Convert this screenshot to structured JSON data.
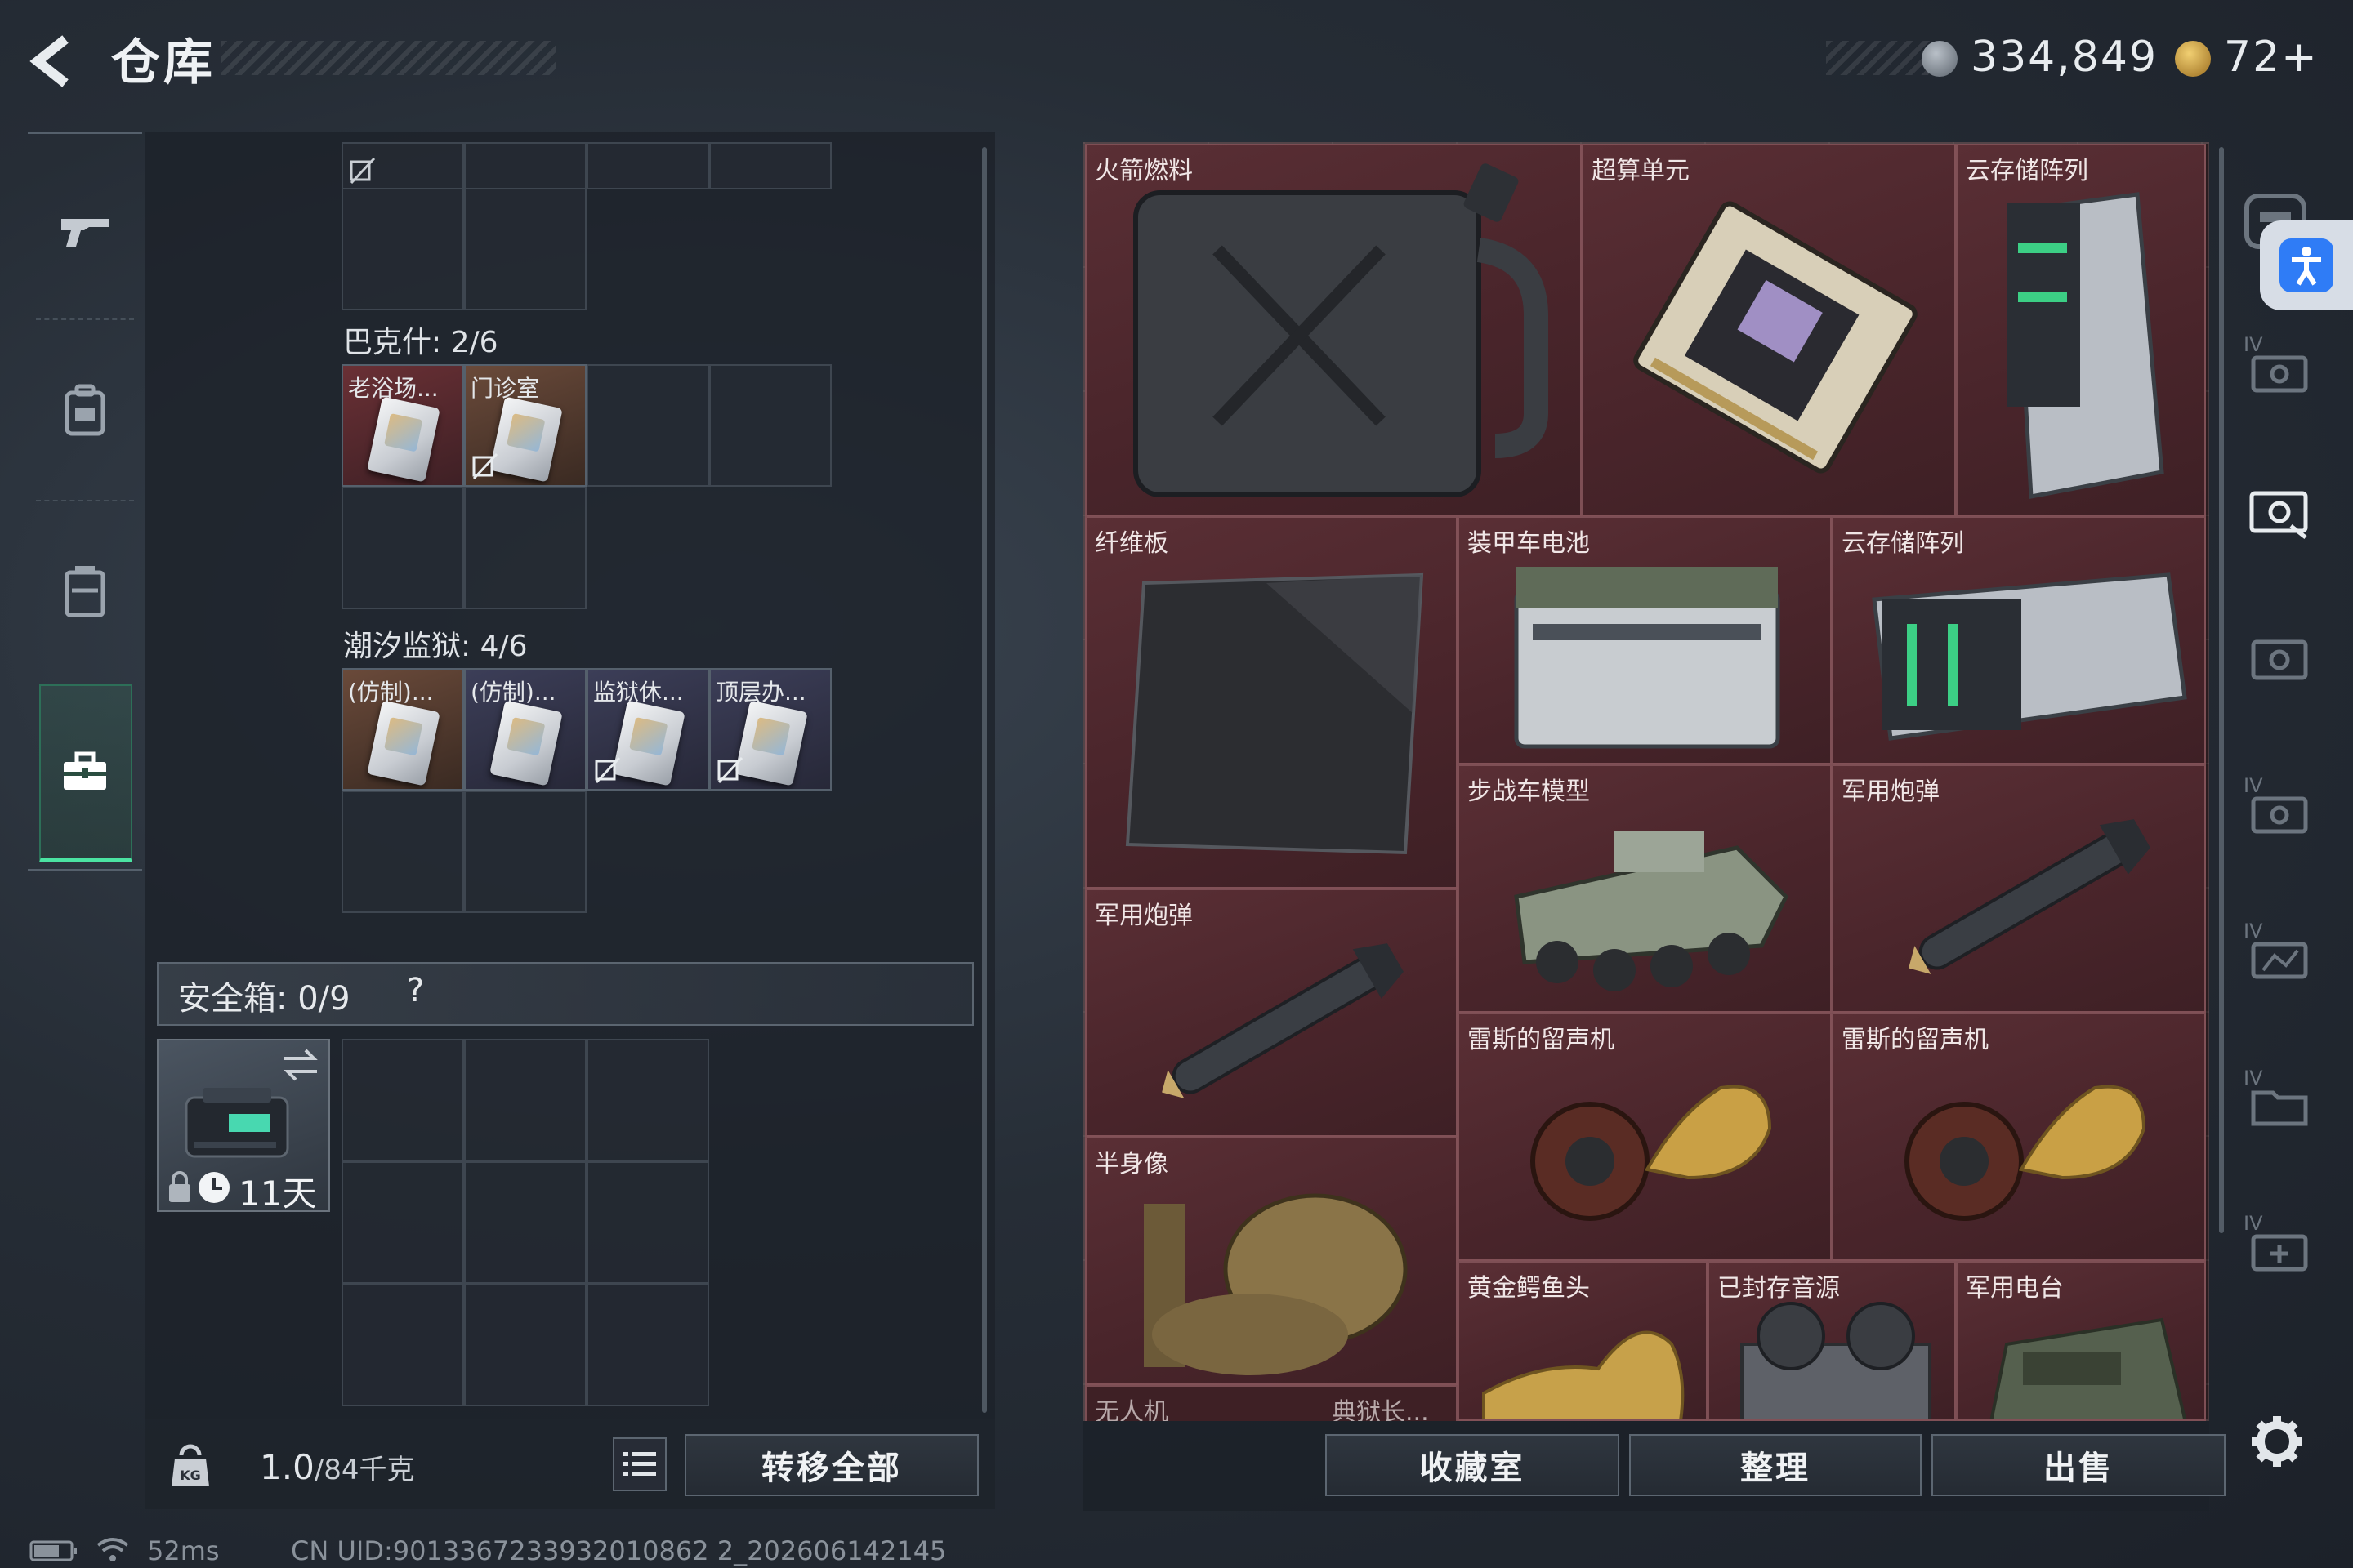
{
  "header": {
    "title": "仓库",
    "currency_primary": "334,849",
    "currency_secondary": "72+"
  },
  "sections": {
    "first_tag": "",
    "bakesh": {
      "label": "巴克什: 2/6",
      "items": [
        "老浴场...",
        "门诊室"
      ]
    },
    "chaoxi": {
      "label": "潮汐监狱: 4/6",
      "items": [
        "(仿制)...",
        "(仿制)...",
        "监狱休...",
        "顶层办..."
      ]
    }
  },
  "safe_box": {
    "label": "安全箱: 0/9",
    "help": "?",
    "item_timer": "11天"
  },
  "footer_left": {
    "weight_value": "1.0",
    "weight_unit": "/84千克",
    "transfer_all": "转移全部"
  },
  "storage_items": [
    "火箭燃料",
    "超算单元",
    "云存储阵列",
    "纤维板",
    "装甲车电池",
    "云存储阵列",
    "步战车模型",
    "军用炮弹",
    "军用炮弹",
    "雷斯的留声机",
    "雷斯的留声机",
    "半身像",
    "黄金鳄鱼头",
    "已封存音源",
    "军用电台",
    "无人机",
    "典狱长..."
  ],
  "footer_right": {
    "collection_room": "收藏室",
    "organize": "整理",
    "sell": "出售"
  },
  "status_bar": {
    "ping": "52ms",
    "uid": "CN UID:9013367233932010862 2_202606142145"
  },
  "right_nav_labels": [
    "IV",
    "IV",
    "IV",
    "IV",
    "IV"
  ],
  "colors": {
    "accent_green": "#4be3a2",
    "storage_bg": "#4a252b",
    "access_blue": "#2f7cf6"
  }
}
